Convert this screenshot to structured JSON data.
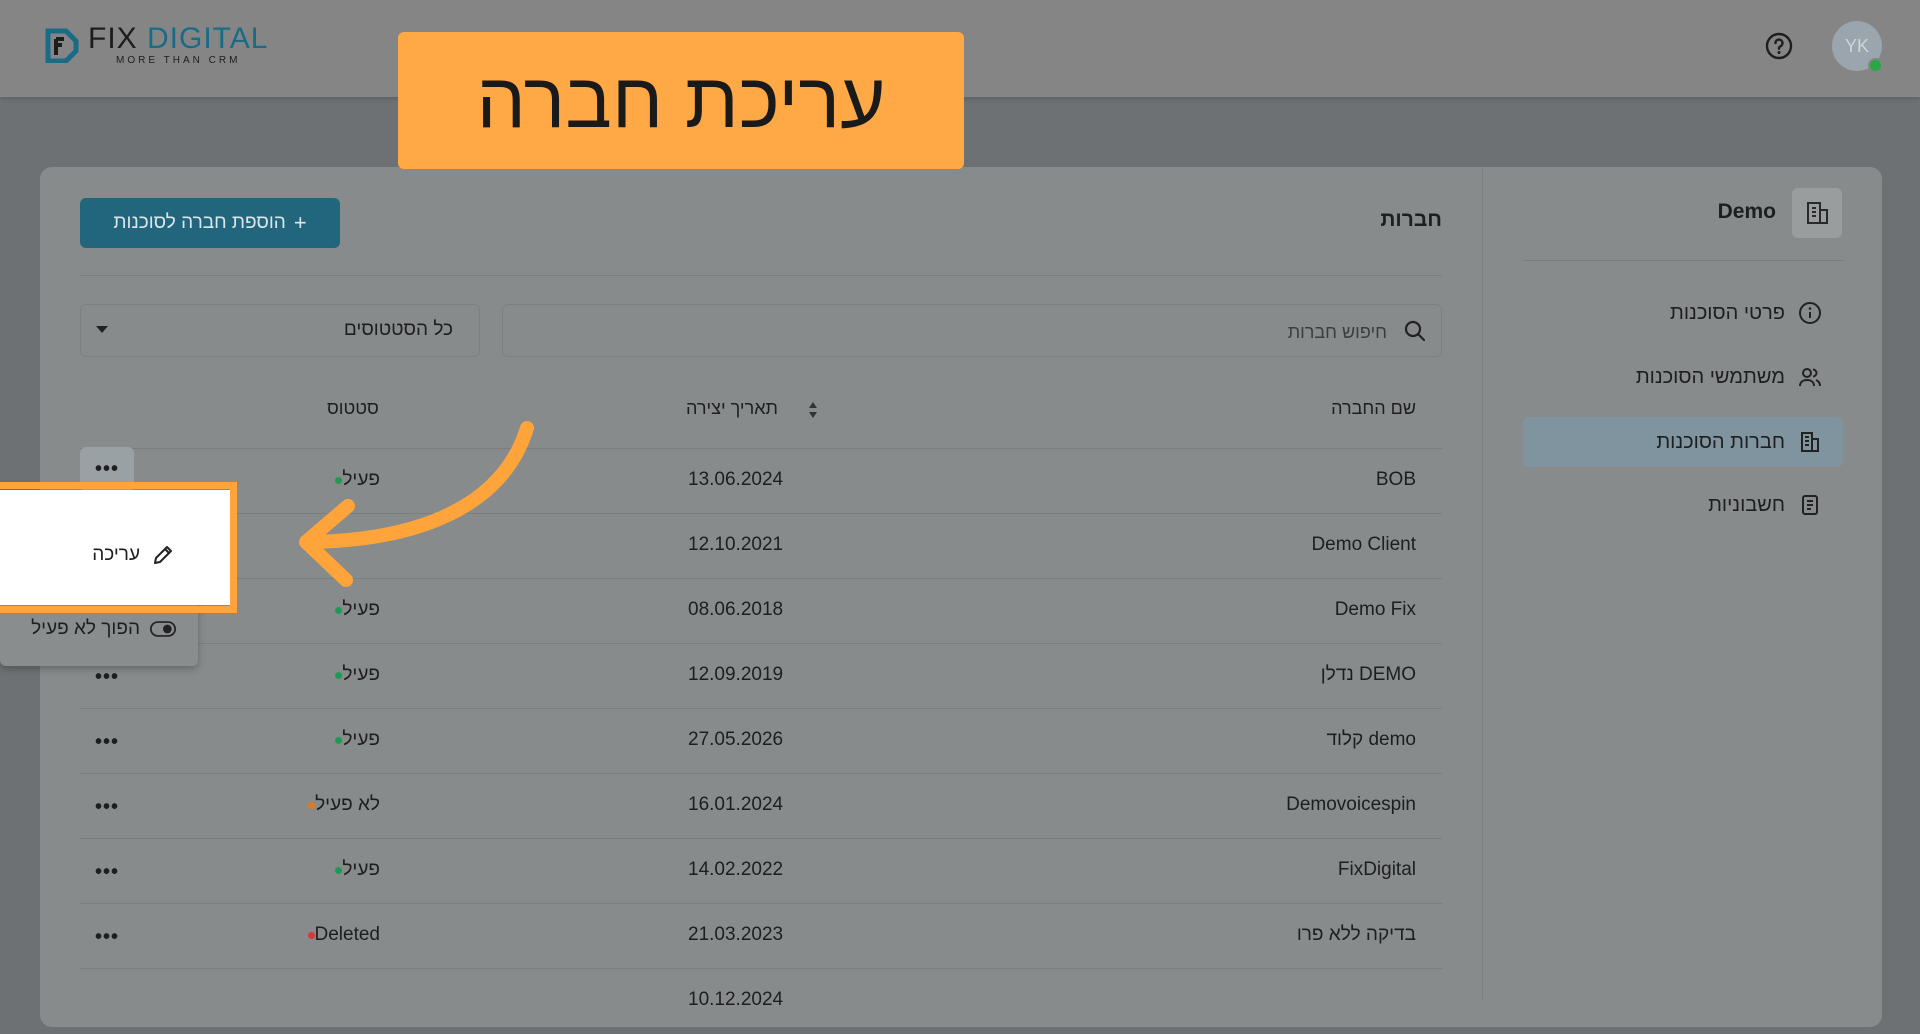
{
  "header": {
    "logo_main_a": "FIX",
    "logo_main_b": "DIGITAL",
    "logo_tagline": "MORE THAN CRM",
    "avatar_initials": "YK"
  },
  "banner": {
    "text": "עריכת חברה"
  },
  "sidebar": {
    "agency_name": "Demo",
    "items": [
      {
        "label": "פרטי הסוכנות",
        "icon": "info-icon",
        "active": false
      },
      {
        "label": "משתמשי הסוכנות",
        "icon": "users-icon",
        "active": false
      },
      {
        "label": "חברות הסוכנות",
        "icon": "building-icon",
        "active": true
      },
      {
        "label": "חשבוניות",
        "icon": "invoice-icon",
        "active": false
      }
    ]
  },
  "main": {
    "title": "חברות",
    "add_button": "הוספת חברה לסוכנות",
    "search_placeholder": "חיפוש חברות",
    "status_filter": "כל הסטטוסים",
    "columns": {
      "name": "שם החברה",
      "created": "תאריך יצירה",
      "status": "סטטוס"
    }
  },
  "rows": [
    {
      "name": "BOB",
      "date": "13.06.2024",
      "status": "פעיל",
      "status_color": "#1f9a53"
    },
    {
      "name": "Demo Client",
      "date": "12.10.2021",
      "status": "",
      "status_color": ""
    },
    {
      "name": "Demo Fix",
      "date": "08.06.2018",
      "status": "פעיל",
      "status_color": "#1f9a53"
    },
    {
      "name": "DEMO נדלן",
      "date": "12.09.2019",
      "status": "פעיל",
      "status_color": "#1f9a53"
    },
    {
      "name": "demo קלוד",
      "date": "27.05.2026",
      "status": "פעיל",
      "status_color": "#1f9a53"
    },
    {
      "name": "Demovoicespin",
      "date": "16.01.2024",
      "status": "לא פעיל",
      "status_color": "#e07a1f"
    },
    {
      "name": "FixDigital",
      "date": "14.02.2022",
      "status": "פעיל",
      "status_color": "#1f9a53"
    },
    {
      "name": "בדיקה ללא פרו",
      "date": "21.03.2023",
      "status": "Deleted",
      "status_color": "#d63a3a"
    },
    {
      "name": "",
      "date": "10.12.2024",
      "status": "",
      "status_color": ""
    }
  ],
  "menu": {
    "edit": "עריכה",
    "deactivate": "הפוך לא פעיל"
  },
  "more_label": "•••",
  "colors": {
    "accent": "#21667c",
    "highlight": "#ffa43a",
    "active_status": "#1f9a53",
    "inactive_status": "#e07a1f",
    "deleted_status": "#d63a3a"
  }
}
